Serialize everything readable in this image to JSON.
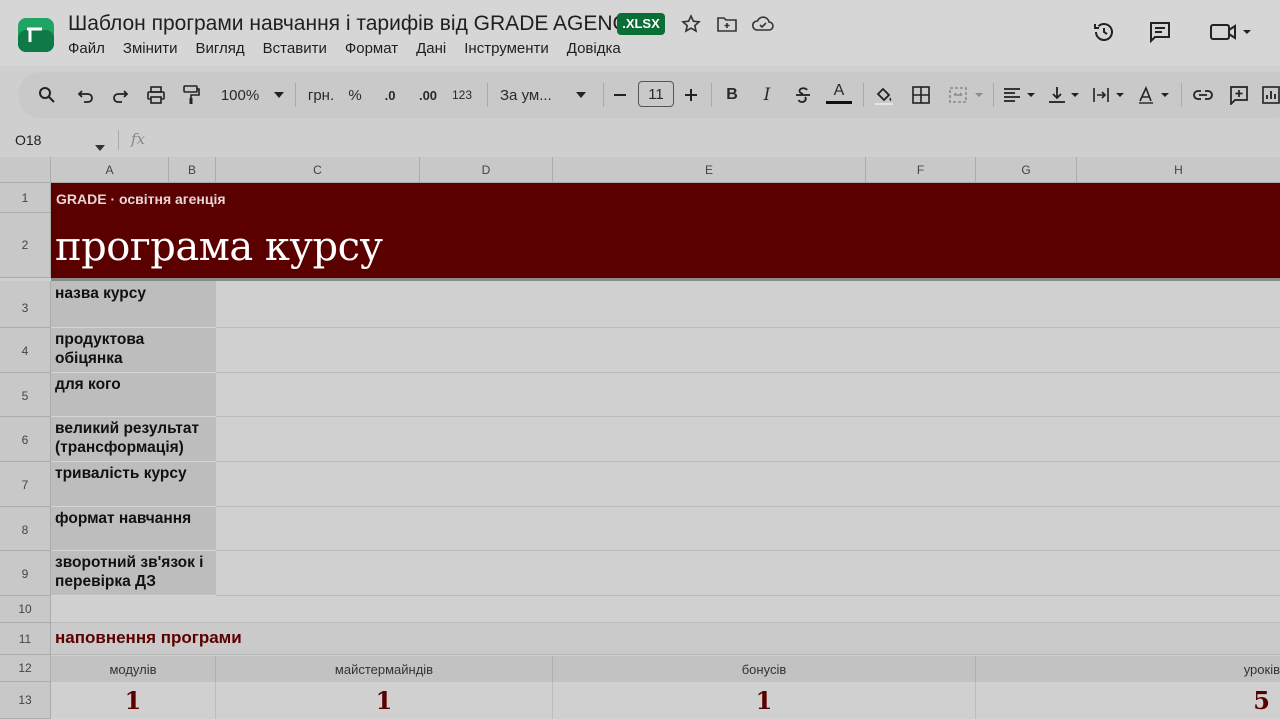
{
  "document": {
    "title": "Шаблон програми навчання і тарифів від GRADE AGENCY",
    "badge": ".XLSX"
  },
  "menu": [
    "Файл",
    "Змінити",
    "Вигляд",
    "Вставити",
    "Формат",
    "Дані",
    "Інструменти",
    "Довідка"
  ],
  "toolbar": {
    "zoom": "100%",
    "currency": "грн.",
    "percent": "%",
    "decrease_decimal": ".0",
    "increase_decimal": ".00",
    "number_format": "123",
    "font": "За ум...",
    "font_size": "11",
    "bold": "B",
    "italic": "I",
    "text_color": "A"
  },
  "formula_bar": {
    "cell_ref": "O18",
    "fx": "fx",
    "value": ""
  },
  "columns": [
    "A",
    "B",
    "C",
    "D",
    "E",
    "F",
    "G",
    "H"
  ],
  "rows": [
    "1",
    "2",
    "3",
    "4",
    "5",
    "6",
    "7",
    "8",
    "9",
    "10",
    "11",
    "12",
    "13"
  ],
  "banner": {
    "subtitle": "GRADE · освітня агенція",
    "title": "програма курсу"
  },
  "labels": [
    "назва курсу",
    "продуктова обіцянка",
    "для кого",
    "великий результат (трансформація)",
    "тривалість курсу",
    "формат навчання",
    "зворотний зв'язок і перевірка ДЗ"
  ],
  "program": {
    "title": "наповнення програми",
    "headers": [
      "модулів",
      "майстермайндів",
      "бонусів",
      "уроків"
    ],
    "values": [
      "1",
      "1",
      "1",
      "5"
    ]
  },
  "colors": {
    "brand": "#5a0000",
    "badge": "#0b6e35"
  }
}
